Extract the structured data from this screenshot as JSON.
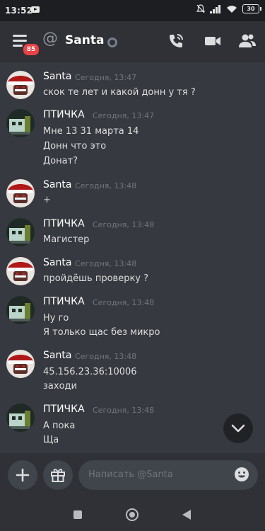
{
  "status_bar": {
    "time": "13:52",
    "battery": "30"
  },
  "header": {
    "unread_badge": "85",
    "at_symbol": "@",
    "title": "Santa"
  },
  "messages": [
    {
      "author": "Santa",
      "timestamp": "Сегодня, 13:47",
      "lines": [
        "скок те лет и какой донн у тя ?"
      ]
    },
    {
      "author": "ПТИЧКА",
      "timestamp": "Сегодня, 13:47",
      "lines": [
        "Мне 13 31 марта 14",
        "Донн что это",
        "Донат?"
      ]
    },
    {
      "author": "Santa",
      "timestamp": "Сегодня, 13:48",
      "lines": [
        "+"
      ]
    },
    {
      "author": "ПТИЧКА",
      "timestamp": "Сегодня, 13:48",
      "lines": [
        "Магистер"
      ]
    },
    {
      "author": "Santa",
      "timestamp": "Сегодня, 13:48",
      "lines": [
        "пройдёшь проверку ?"
      ]
    },
    {
      "author": "ПТИЧКА",
      "timestamp": "Сегодня, 13:48",
      "lines": [
        "Ну го",
        "Я только щас без микро"
      ]
    },
    {
      "author": "Santa",
      "timestamp": "Сегодня, 13:48",
      "lines": [
        "45.156.23.36:10006",
        "заходи"
      ]
    },
    {
      "author": "ПТИЧКА",
      "timestamp": "Сегодня, 13:48",
      "lines": [
        "А пока",
        "Ща"
      ]
    }
  ],
  "composer": {
    "placeholder": "Написать @Santa"
  },
  "colors": {
    "background": "#36393f",
    "header": "#2f3136",
    "badge": "#ed4245",
    "timestamp": "#72767d",
    "text": "#dcddde"
  },
  "icons": {
    "menu": "hamburger-icon",
    "call": "phone-call-icon",
    "video": "video-camera-icon",
    "members": "members-icon",
    "scroll": "chevron-down-icon",
    "add": "plus-icon",
    "gift": "gift-icon",
    "emoji": "emoji-icon"
  }
}
